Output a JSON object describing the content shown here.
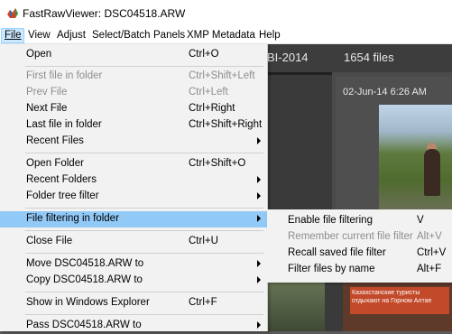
{
  "window": {
    "title": "FastRawViewer: DSC04518.ARW"
  },
  "menubar": [
    {
      "label": "File",
      "active": true
    },
    {
      "label": "View"
    },
    {
      "label": "Adjust"
    },
    {
      "label": "Select/Batch"
    },
    {
      "label": "Panels"
    },
    {
      "label": "XMP Metadata"
    },
    {
      "label": "Help"
    }
  ],
  "background": {
    "folder_year": "BI-2014",
    "file_count": "1654 files",
    "thumb_date": "02-Jun-14 6:26 AM",
    "banner_text": "Казахстанские туристы отдыхают на Горном Алтае"
  },
  "file_menu": [
    {
      "label": "Open",
      "shortcut": "Ctrl+O"
    },
    {
      "label": "First file in folder",
      "shortcut": "Ctrl+Shift+Left",
      "disabled": true
    },
    {
      "label": "Prev File",
      "shortcut": "Ctrl+Left",
      "disabled": true
    },
    {
      "label": "Next File",
      "shortcut": "Ctrl+Right"
    },
    {
      "label": "Last file in folder",
      "shortcut": "Ctrl+Shift+Right"
    },
    {
      "label": "Recent Files",
      "shortcut": "",
      "submenu": true
    },
    {
      "label": "Open Folder",
      "shortcut": "Ctrl+Shift+O"
    },
    {
      "label": "Recent Folders",
      "shortcut": "",
      "submenu": true
    },
    {
      "label": "Folder tree filter",
      "shortcut": "",
      "submenu": true
    },
    {
      "label": "File filtering in folder",
      "shortcut": "",
      "submenu": true,
      "highlighted": true
    },
    {
      "label": "Close File",
      "shortcut": "Ctrl+U"
    },
    {
      "label": "Move DSC04518.ARW to",
      "shortcut": "",
      "submenu": true
    },
    {
      "label": "Copy DSC04518.ARW to",
      "shortcut": "",
      "submenu": true
    },
    {
      "label": "Show in Windows Explorer",
      "shortcut": "Ctrl+F"
    },
    {
      "label": "Pass DSC04518.ARW to",
      "shortcut": "",
      "submenu": true
    }
  ],
  "submenu_filtering": [
    {
      "label": "Enable file filtering",
      "shortcut": "V"
    },
    {
      "label": "Remember current file filter",
      "shortcut": "Alt+V",
      "disabled": true
    },
    {
      "label": "Recall saved file filter",
      "shortcut": "Ctrl+V"
    },
    {
      "label": "Filter files by name",
      "shortcut": "Alt+F"
    }
  ],
  "colors": {
    "highlight": "#91c9f7",
    "menu_bg": "#f2f2f2",
    "disabled_text": "#8d8d8d"
  }
}
